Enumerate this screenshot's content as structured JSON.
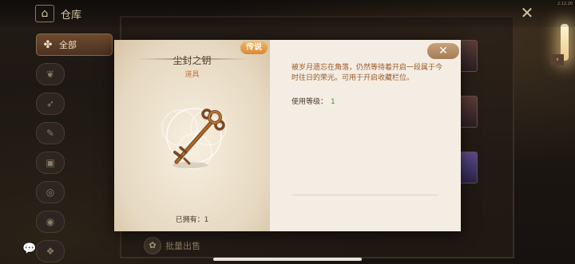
{
  "version": "2.12.20",
  "topbar": {
    "title": "仓库"
  },
  "sidebar": {
    "all_label": "全部"
  },
  "bulk_sell": "批量出售",
  "modal": {
    "rarity": "传说",
    "item_name": "尘封之钥",
    "item_type": "道具",
    "description": "被岁月遗忘在角落，仍然等待着开启一段属于今时往日的荣光。可用于开启收藏栏位。",
    "level_label": "使用等级：",
    "level_value": "1",
    "owned_label": "已拥有：",
    "owned_value": "1"
  },
  "colors": {
    "accent": "#c0703a",
    "rarity_legendary": "#e39a4a",
    "level_value": "#3a9a38"
  }
}
